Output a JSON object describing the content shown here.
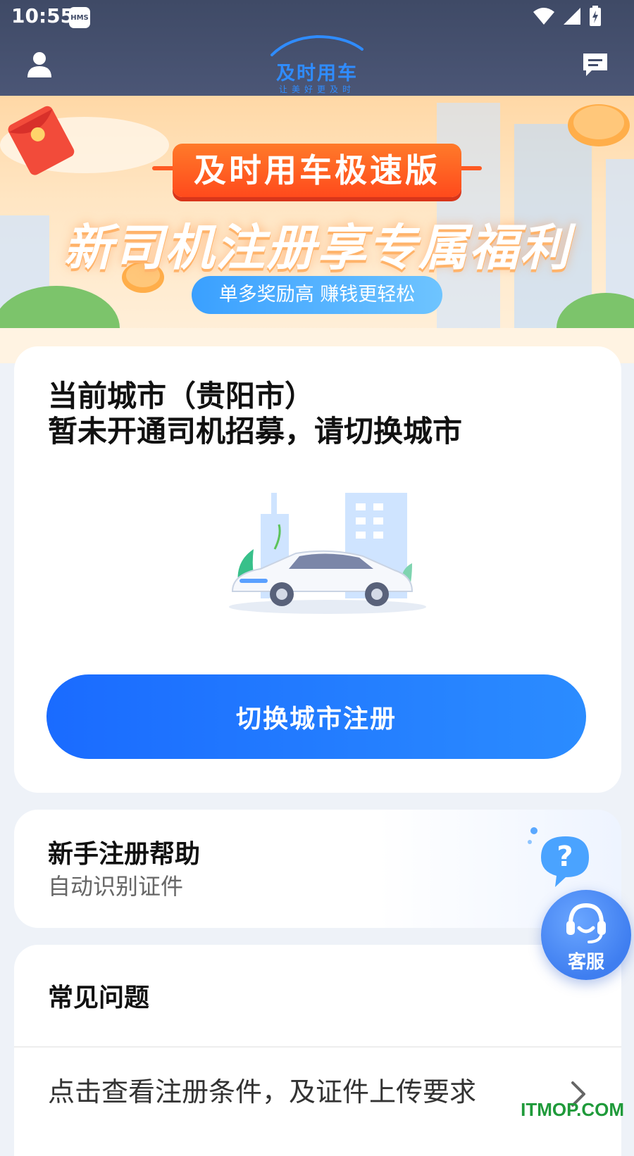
{
  "status_bar": {
    "time": "10:55",
    "badge": "HMS",
    "icons": [
      "wifi-icon",
      "signal-icon",
      "battery-charging-icon"
    ]
  },
  "header": {
    "logo_name": "及时用车",
    "logo_slogan": "让美好更及时",
    "left_icon": "user-icon",
    "right_icon": "message-icon"
  },
  "banner": {
    "ribbon": "及时用车极速版",
    "headline": "新司机注册享专属福利",
    "pill": "单多奖励高 赚钱更轻松"
  },
  "city_card": {
    "line1": "当前城市（贵阳市）",
    "line2": "暂未开通司机招募，请切换城市",
    "button_label": "切换城市注册"
  },
  "help_card": {
    "title": "新手注册帮助",
    "subtitle": "自动识别证件"
  },
  "faq_card": {
    "title": "常见问题",
    "item": "点击查看注册条件，及证件上传要求"
  },
  "service_button": {
    "label": "客服"
  },
  "watermark": "ITMOP.COM",
  "colors": {
    "header_bg": "#414c6a",
    "primary_blue": "#1a6bff",
    "ribbon_orange": "#ff5a22",
    "page_bg": "#eef2f8"
  }
}
